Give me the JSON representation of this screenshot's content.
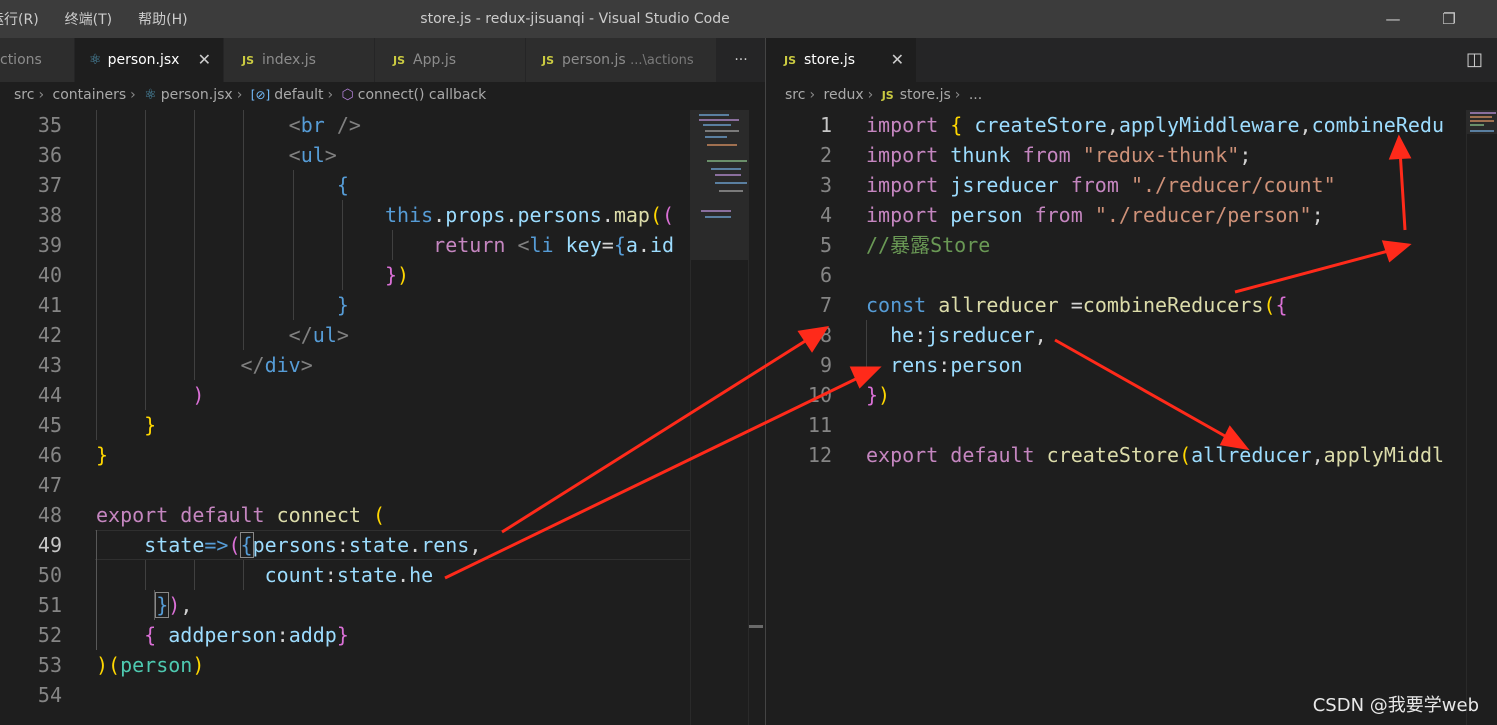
{
  "titlebar": {
    "menu": [
      "运行(R)",
      "终端(T)",
      "帮助(H)"
    ],
    "title": "store.js - redux-jisuanqi - Visual Studio Code",
    "minimize": "—",
    "restore": "❐"
  },
  "left_tabs": [
    {
      "label": "ctions",
      "icon": ""
    },
    {
      "label": "person.jsx",
      "icon": "react-icon",
      "active": true
    },
    {
      "label": "index.js",
      "icon": "JS"
    },
    {
      "label": "App.js",
      "icon": "JS"
    },
    {
      "label": "person.js",
      "icon": "JS",
      "suffix": "...\\actions"
    }
  ],
  "left_tabs_more": "···",
  "right_tab": {
    "label": "store.js",
    "icon": "JS",
    "close": "✕"
  },
  "split_icon": "◫",
  "left_breadcrumb": [
    "src",
    "containers",
    "person.jsx",
    "default",
    "connect() callback"
  ],
  "right_breadcrumb": [
    "src",
    "redux",
    "store.js",
    "..."
  ],
  "left_editor": {
    "line_numbers": [
      "35",
      "36",
      "37",
      "38",
      "39",
      "40",
      "41",
      "42",
      "43",
      "44",
      "45",
      "46",
      "47",
      "48",
      "49",
      "50",
      "51",
      "52",
      "53",
      "54"
    ],
    "current_line": "49"
  },
  "right_editor": {
    "line_numbers": [
      "1",
      "2",
      "3",
      "4",
      "5",
      "6",
      "7",
      "8",
      "9",
      "10",
      "11",
      "12"
    ],
    "current_line": "1"
  },
  "code_tokens": {
    "br": "br",
    "ul": "ul",
    "div": "div",
    "li": "li",
    "this_": "this",
    "props": "props",
    "persons": "persons",
    "map": "map",
    "return_": "return",
    "key": "key",
    "a": "a",
    "id": "id",
    "export_": "export",
    "default_": "default",
    "connect": "connect",
    "state": "state",
    "rens": "rens",
    "count": "count",
    "he": "he",
    "addperson": "addperson",
    "addp": "addp",
    "person": "person",
    "import_": "import",
    "from_": "from",
    "createStore": "createStore",
    "applyMiddleware": "applyMiddleware",
    "combineRedu": "combineRedu",
    "thunk": "thunk",
    "redux_thunk": "\"redux-thunk\"",
    "jsreducer": "jsreducer",
    "count_path": "\"./reducer/count\"",
    "person_path": "\"./reducer/person\"",
    "comment": "//暴露Store",
    "const_": "const",
    "allreducer": "allreducer",
    "combineReducers": "combineReducers",
    "applyMiddl": "applyMiddl"
  },
  "watermark": "CSDN @我要学web",
  "colors": {
    "arrow": "#ff2a1a",
    "keyword": "#569cd6",
    "control": "#c586c0",
    "string": "#ce9178"
  }
}
